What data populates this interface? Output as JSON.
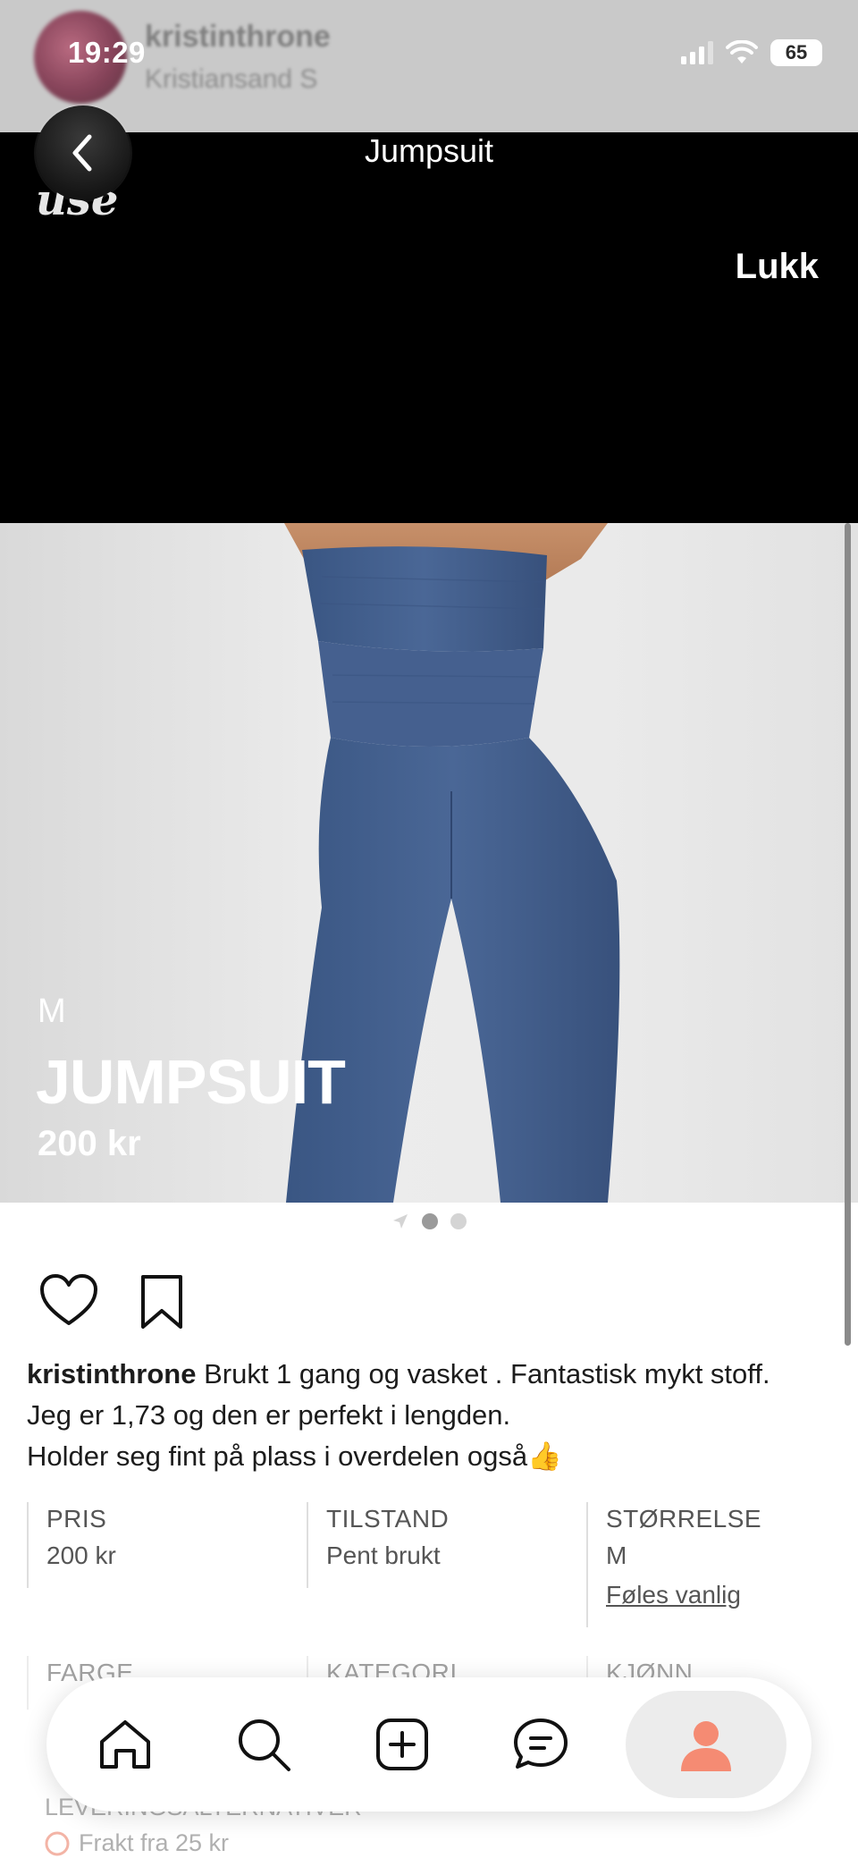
{
  "status_bar": {
    "time": "19:29",
    "battery": "65"
  },
  "background_profile": {
    "username": "kristinthrone",
    "location": "Kristiansand S"
  },
  "header": {
    "title": "Jumpsuit",
    "close_label": "Lukk",
    "logo_text": "use"
  },
  "hero": {
    "size": "M",
    "name": "JUMPSUIT",
    "price": "200 kr"
  },
  "carousel": {
    "dot_count": 2,
    "active_index": 0
  },
  "post": {
    "username": "kristinthrone",
    "description_line1": " Brukt 1 gang og vasket . Fantastisk mykt stoff.",
    "description_line2": "Jeg er 1,73 og den er perfekt i lengden.",
    "description_line3": "Holder seg fint på plass i overdelen også👍"
  },
  "details": {
    "price_label": "PRIS",
    "price_value": "200 kr",
    "condition_label": "TILSTAND",
    "condition_value": "Pent brukt",
    "size_label": "STØRRELSE",
    "size_value": "M",
    "size_fit": "Føles vanlig",
    "color_label": "FARGE",
    "category_label": "KATEGORI",
    "gender_label": "KJØNN"
  },
  "shipping": {
    "label": "LEVERINGSALTERNATIVER",
    "fee": "Frakt fra 25 kr"
  },
  "nav": {
    "items": [
      "home-icon",
      "search-icon",
      "add-icon",
      "messages-icon",
      "profile-icon"
    ],
    "active": "profile-icon",
    "accent_color": "#f58b73"
  }
}
